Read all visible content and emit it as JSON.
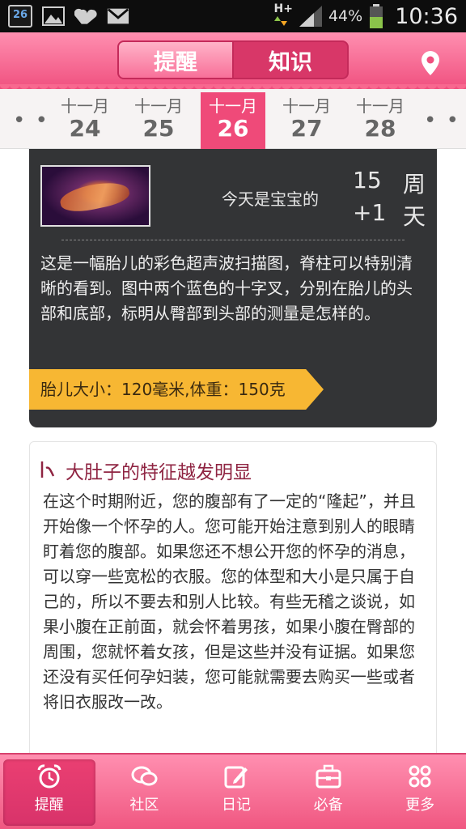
{
  "status_bar": {
    "calendar_date": "26",
    "network": "H+",
    "battery": "44%",
    "time": "10:36",
    "icons": [
      "calendar-icon",
      "gallery-icon",
      "heart-icon",
      "gmail-icon",
      "data-arrows-icon",
      "signal-icon",
      "battery-icon"
    ]
  },
  "header": {
    "tabs": [
      {
        "label": "提醒",
        "active": true
      },
      {
        "label": "知识",
        "active": false
      }
    ],
    "location_icon": "location-pin-icon"
  },
  "date_strip": {
    "left_dots": "• •",
    "right_dots": "• •",
    "dates": [
      {
        "month": "十一月",
        "day": "24",
        "active": false
      },
      {
        "month": "十一月",
        "day": "25",
        "active": false
      },
      {
        "month": "十一月",
        "day": "26",
        "active": true
      },
      {
        "month": "十一月",
        "day": "27",
        "active": false
      },
      {
        "month": "十一月",
        "day": "28",
        "active": false
      }
    ]
  },
  "baby_card": {
    "today_text": "今天是宝宝的",
    "weeks": "15",
    "weeks_unit": "周",
    "days": "+1",
    "days_unit": "天",
    "description": "这是一幅胎儿的彩色超声波扫描图，脊柱可以特别清晰的看到。图中两个蓝色的十字叉，分别在胎儿的头部和底部，标明从臀部到头部的测量是怎样的。",
    "size_info": "胎儿大小：120毫米,体重：150克"
  },
  "article": {
    "title": "大肚子的特征越发明显",
    "body": "在这个时期附近，您的腹部有了一定的“隆起”，并且开始像一个怀孕的人。您可能开始注意到别人的眼睛盯着您的腹部。如果您还不想公开您的怀孕的消息，可以穿一些宽松的衣服。您的体型和大小是只属于自己的，所以不要去和别人比较。有些无稽之谈说，如果小腹在正前面，就会怀着男孩，如果小腹在臀部的周围，您就怀着女孩，但是这些并没有证据。如果您还没有买任何孕妇装，您可能就需要去购买一些或者将旧衣服改一改。"
  },
  "bottom_nav": {
    "items": [
      {
        "label": "提醒",
        "icon": "alarm-clock-icon",
        "active": true
      },
      {
        "label": "社区",
        "icon": "chat-bubbles-icon",
        "active": false
      },
      {
        "label": "日记",
        "icon": "edit-note-icon",
        "active": false
      },
      {
        "label": "必备",
        "icon": "toolbox-icon",
        "active": false
      },
      {
        "label": "更多",
        "icon": "more-grid-icon",
        "active": false
      }
    ]
  }
}
